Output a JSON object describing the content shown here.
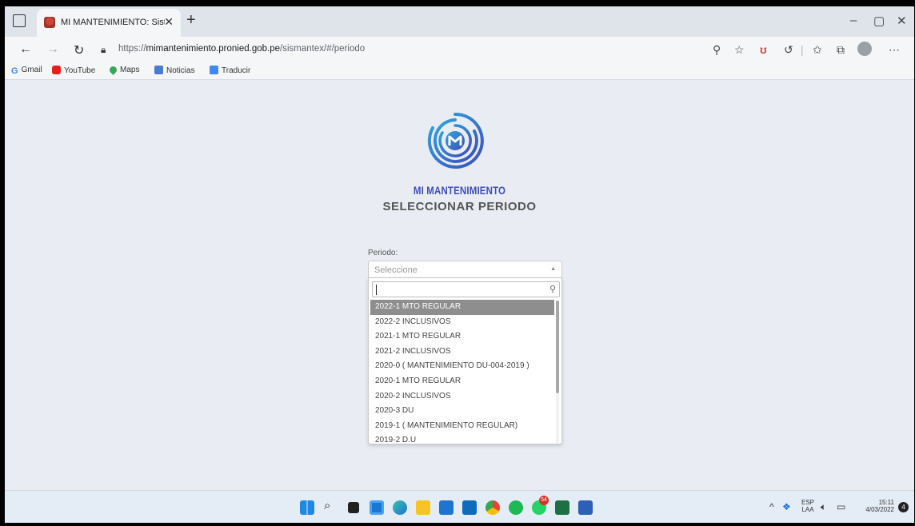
{
  "browser": {
    "tab_title": "MI MANTENIMIENTO: Sistema d",
    "url_prefix": "https://",
    "url_domain": "mimantenimiento.pronied.gob.pe",
    "url_path": "/sismantex/#/periodo",
    "window_controls": {
      "minimize": "–",
      "restore": "▢",
      "close": "✕"
    },
    "new_tab": "+",
    "tab_close": "✕"
  },
  "bookmarks": [
    {
      "label": "Gmail",
      "icon": "google-icon",
      "color": "#4285f4"
    },
    {
      "label": "YouTube",
      "icon": "youtube-icon",
      "color": "#e62117"
    },
    {
      "label": "Maps",
      "icon": "maps-icon",
      "color": "#34a853"
    },
    {
      "label": "Noticias",
      "icon": "news-icon",
      "color": "#4a7bd6"
    },
    {
      "label": "Traducir",
      "icon": "translate-icon",
      "color": "#4285f4"
    }
  ],
  "page": {
    "brand": "MI MANTENIMIENTO",
    "heading": "SELECCIONAR PERIODO",
    "period_label": "Periodo:",
    "select_placeholder": "Seleccione",
    "options": [
      "2022-1 MTO REGULAR",
      "2022-2 INCLUSIVOS",
      "2021-1 MTO REGULAR",
      "2021-2 INCLUSIVOS",
      "2020-0 ( MANTENIMIENTO DU-004-2019 )",
      "2020-1 MTO REGULAR",
      "2020-2 INCLUSIVOS",
      "2020-3 DU",
      "2019-1 ( MANTENIMIENTO REGULAR)",
      "2019-2 D.U"
    ],
    "highlighted_index": 0,
    "brand_color": "#3d4eb8"
  },
  "taskbar": {
    "language": "ESP",
    "language_sub": "LAA",
    "time": "15:11",
    "date": "4/03/2022",
    "whatsapp_badge": "54",
    "notification_count": "4"
  }
}
